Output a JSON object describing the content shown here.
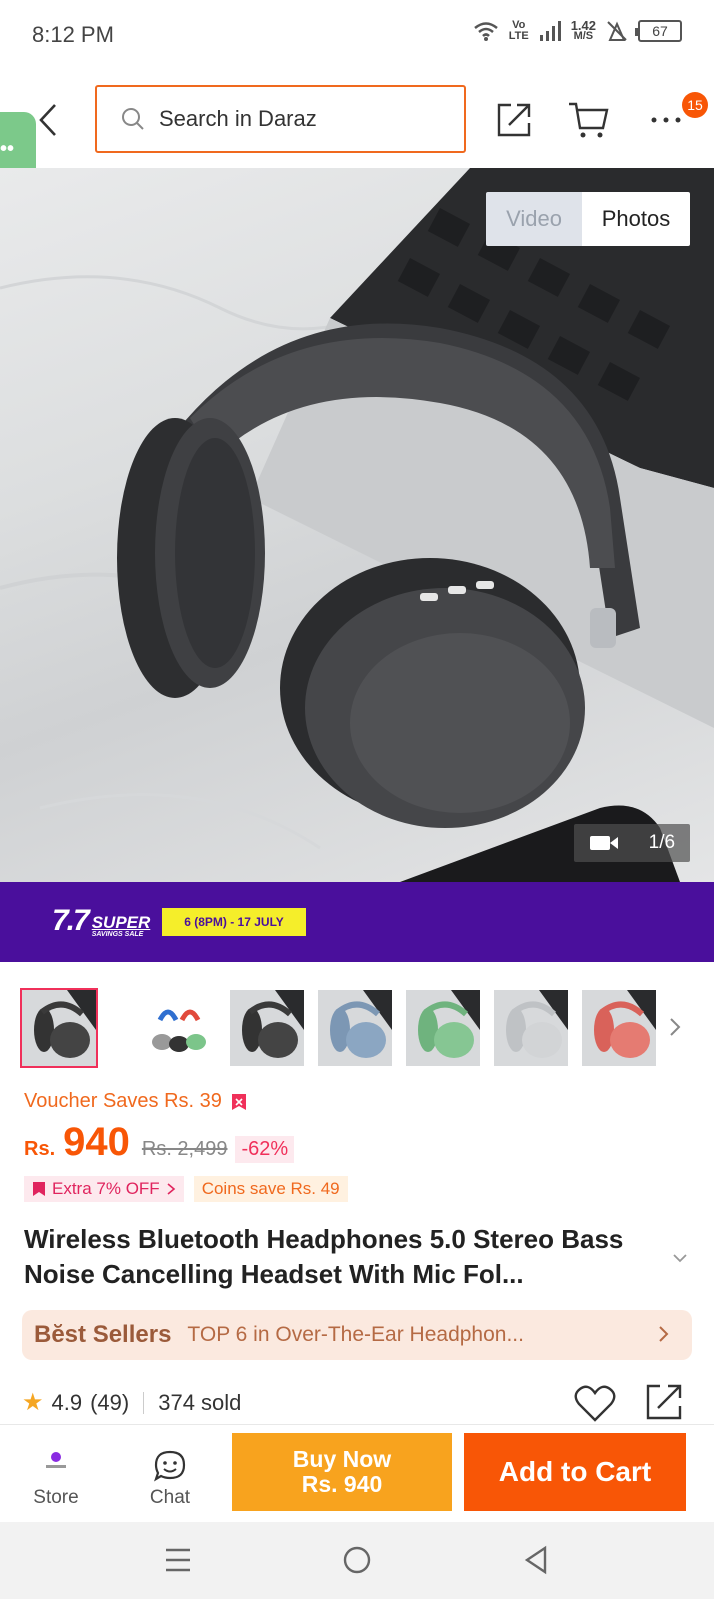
{
  "status_bar": {
    "time": "8:12 PM",
    "net_type_top": "Vo",
    "net_type_bottom": "LTE",
    "speed_value": "1.42",
    "speed_unit": "M/S",
    "battery": "67",
    "icons": [
      "wifi-icon",
      "signal-icon",
      "alert-icon",
      "battery-icon"
    ]
  },
  "header": {
    "search_placeholder": "Search in Daraz",
    "more_badge": "15",
    "side_tab": "••"
  },
  "gallery": {
    "toggle_video": "Video",
    "toggle_photos": "Photos",
    "counter": "1/6"
  },
  "banner": {
    "logo_number": "7.7",
    "logo_super": "SUPER",
    "logo_sub": "SAVINGS SALE",
    "date_text": "6 (8PM) - 17 JULY",
    "bg_color": "#4a0f9c"
  },
  "thumbnails": [
    "black",
    "set",
    "black",
    "blue",
    "green",
    "silver",
    "red"
  ],
  "pricing": {
    "voucher": "Voucher Saves Rs. 39",
    "currency": "Rs.",
    "price": "940",
    "old_price": "Rs. 2,499",
    "discount": "-62%",
    "extra_off": "Extra 7% OFF",
    "coins": "Coins save Rs. 49",
    "accent_color": "#f85606"
  },
  "product": {
    "title": "Wireless Bluetooth Headphones 5.0 Stereo Bass Noise Cancelling Headset With Mic Fol..."
  },
  "best_sellers": {
    "label": "Bĕst Sellers",
    "text": "TOP 6 in Over-The-Ear Headphon..."
  },
  "rating": {
    "score": "4.9",
    "count": "(49)",
    "sold": "374 sold"
  },
  "actions": {
    "store": "Store",
    "chat": "Chat",
    "buy_now_line1": "Buy Now",
    "buy_now_line2": "Rs. 940",
    "add_to_cart": "Add to Cart"
  }
}
